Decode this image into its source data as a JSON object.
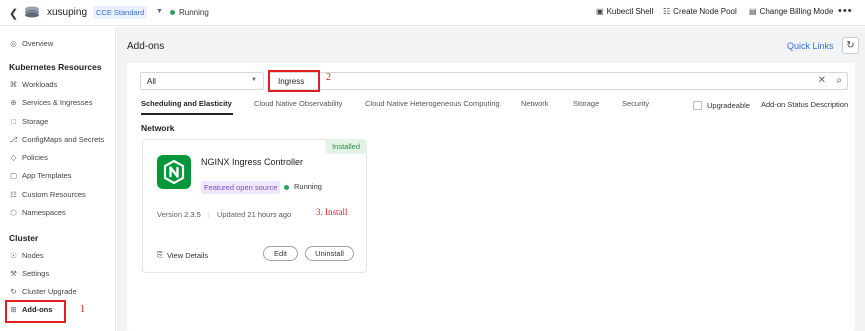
{
  "topbar": {
    "back_icon": "chevron-left-icon",
    "cluster_name": "xusuping",
    "edition": "CCE Standard",
    "status": "Running",
    "actions": [
      {
        "label": "Kubectl Shell",
        "icon": "terminal-icon"
      },
      {
        "label": "Create Node Pool",
        "icon": "node-pool-icon"
      },
      {
        "label": "Change Billing Mode",
        "icon": "billing-icon"
      }
    ],
    "more_label": "•••"
  },
  "sidebar": {
    "overview": "Overview",
    "section_k8s": "Kubernetes Resources",
    "k8s_items": [
      "Workloads",
      "Services & Ingresses",
      "Storage",
      "ConfigMaps and Secrets",
      "Policies",
      "App Templates",
      "Custom Resources",
      "Namespaces"
    ],
    "section_cluster": "Cluster",
    "cluster_items": [
      "Nodes",
      "Settings",
      "Cluster Upgrade",
      "Add-ons"
    ],
    "active_item": "Add-ons"
  },
  "main": {
    "title": "Add-ons",
    "quick_links": "Quick Links",
    "filter_select": "All",
    "search_value": "Ingress",
    "tabs": [
      "Scheduling and Elasticity",
      "Cloud Native Observability",
      "Cloud Native Heterogeneous Computing",
      "Network",
      "Storage",
      "Security"
    ],
    "active_tab": "Scheduling and Elasticity",
    "upgradeable_label": "Upgradeable",
    "status_desc_label": "Add-on Status Description",
    "section": "Network",
    "card": {
      "installed_tag": "Installed",
      "name": "NGINX Ingress Controller",
      "badge": "Featured open source",
      "status": "Running",
      "version_label": "Version",
      "version": "2.3.5",
      "updated_label": "Updated",
      "updated": "21 hours ago",
      "view_details": "View Details",
      "edit": "Edit",
      "uninstall": "Uninstall"
    }
  },
  "annotations": {
    "step1": "1",
    "step2": "2",
    "step3": "3. Install"
  },
  "colors": {
    "accent": "#3a6fd8",
    "running": "#29a35a",
    "nginx": "#009639",
    "annotation": "#e02020"
  }
}
